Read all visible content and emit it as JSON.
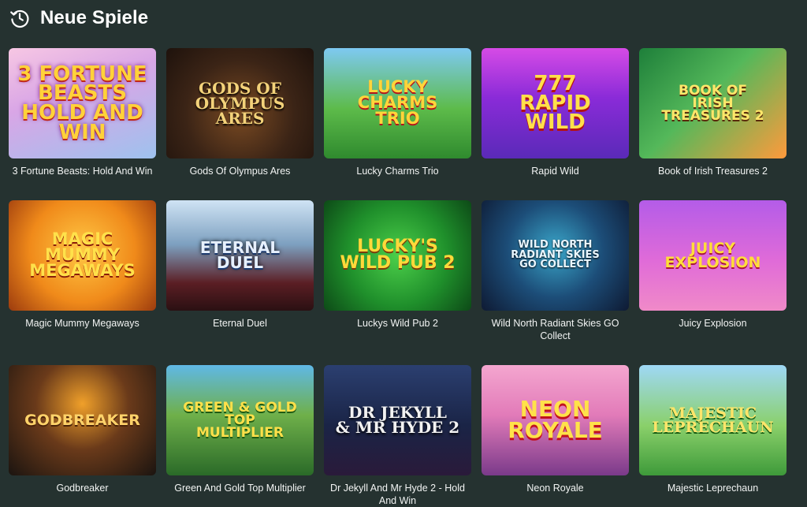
{
  "header": {
    "icon": "clock-history-icon",
    "title": "Neue Spiele"
  },
  "games": [
    {
      "title": "3 Fortune Beasts: Hold And Win",
      "logo": "3 Fortune Beasts\nHold and Win"
    },
    {
      "title": "Gods Of Olympus Ares",
      "logo": "Gods of\nOlympus\nAres"
    },
    {
      "title": "Lucky Charms Trio",
      "logo": "Lucky\nCharms\nTrio"
    },
    {
      "title": "Rapid Wild",
      "logo": "777\nRapid\nWild"
    },
    {
      "title": "Book of Irish Treasures 2",
      "logo": "Book of\nIrish Treasures 2"
    },
    {
      "title": "Magic Mummy Megaways",
      "logo": "Magic\nMummy\nMegaways"
    },
    {
      "title": "Eternal Duel",
      "logo": "Eternal\nDuel"
    },
    {
      "title": "Luckys Wild Pub 2",
      "logo": "Lucky's\nWild Pub 2"
    },
    {
      "title": "Wild North Radiant Skies GO Collect",
      "logo": "Wild North\nRadiant Skies\nGO Collect"
    },
    {
      "title": "Juicy Explosion",
      "logo": "Juicy\nExplosion"
    },
    {
      "title": "Godbreaker",
      "logo": "Godbreaker"
    },
    {
      "title": "Green And Gold Top Multiplier",
      "logo": "Green & Gold\nTop\nMultiplier"
    },
    {
      "title": "Dr Jekyll And Mr Hyde 2 - Hold And Win",
      "logo": "Dr Jekyll\n& Mr Hyde 2"
    },
    {
      "title": "Neon Royale",
      "logo": "Neon\nRoyale"
    },
    {
      "title": "Majestic Leprechaun",
      "logo": "Majestic\nLeprechaun"
    }
  ]
}
